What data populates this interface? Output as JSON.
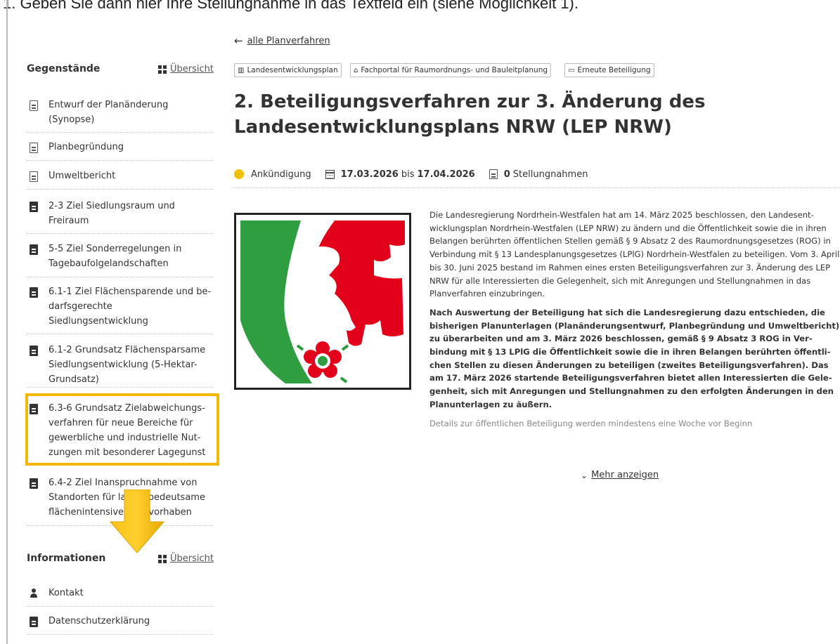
{
  "caption": "1.  Geben Sie dann hier Ihre Stellungnahme in das Textfeld ein (siehe Möglichkeit 1).",
  "sidebar": {
    "gegenstaende": {
      "title": "Gegenstände",
      "overview": "Übersicht",
      "items": [
        {
          "label": "Entwurf der Planänderung (Synopse)",
          "icon": "document-outline-icon"
        },
        {
          "label": "Planbegründung",
          "icon": "document-outline-icon"
        },
        {
          "label": "Umweltbericht",
          "icon": "document-outline-icon"
        },
        {
          "label": "2-3 Ziel Siedlungsraum und Freiraum",
          "icon": "document-filled-icon"
        },
        {
          "label": "5-5 Ziel Sonderregelungen in Tagebaufolgelandschaften",
          "icon": "document-filled-icon"
        },
        {
          "label": "6.1-1 Ziel Flächensparende und be­darfsgerechte Siedlungsentwicklung",
          "icon": "document-filled-icon"
        },
        {
          "label": "6.1-2 Grundsatz Flächensparsame Siedlungsentwicklung (5-Hektar-Grundsatz)",
          "icon": "document-filled-icon"
        },
        {
          "label": "6.3-6 Grundsatz Zielabweichungs­verfahren für neue Bereiche für gewerbliche und industrielle Nut­zungen mit besonderer Lagegunst",
          "icon": "document-filled-icon"
        },
        {
          "label": "6.4-2 Ziel Inanspruchnahme von Standorten für landesbedeutsame flächenintensive Großvorhaben",
          "icon": "document-filled-icon"
        }
      ]
    },
    "informationen": {
      "title": "Informationen",
      "overview": "Übersicht",
      "items": [
        {
          "label": "Kontakt",
          "icon": "user-icon"
        },
        {
          "label": "Datenschutzerklärung",
          "icon": "document-filled-icon"
        }
      ]
    }
  },
  "main": {
    "back_link": "alle Planverfahren",
    "tags": [
      {
        "label": "Landesentwicklungsplan",
        "icon": "map-icon"
      },
      {
        "label": "Fachportal für Raumordnungs- und Bauleitplanung",
        "icon": "institution-icon"
      },
      {
        "label": "Erneute Beteiligung",
        "icon": "comment-icon"
      }
    ],
    "title": "2. Beteiligungsverfahren zur 3. Änderung des Landesentwicklungsplans NRW (LEP NRW)",
    "status": {
      "label": "Ankündigung",
      "color": "#f0c000"
    },
    "date_start": "17.03.2026",
    "date_sep": "bis",
    "date_end": "17.04.2026",
    "statements_count": "0",
    "statements_label": "Stellungnahmen",
    "paragraphs": [
      "Die Landesregierung Nordrhein-Westfalen hat am 14. März 2025 beschlossen, den Landesent­wicklungsplan Nordrhein-Westfalen (LEP NRW) zu ändern und die Öffentlichkeit sowie die in ihren Belangen berührten öffentlichen Stellen gemäß § 9 Absatz 2 des Raumordnungsgesetzes (ROG) in Verbindung mit § 13 Landesplanungsgesetzes (LPlG) Nordrhein-Westfalen zu beteili­gen. Vom 3. April bis 30. Juni 2025 bestand im Rahmen eines ersten Beteiligungsverfahren zur 3. Änderung des LEP NRW für alle Interessierten die Gelegenheit, sich mit Anregungen und Stellungnahmen in das Planverfahren einzubringen.",
      "Nach Auswertung der Beteiligung hat sich die Landesregierung dazu entschieden, die bisherigen Planunterlagen (Planänderungsentwurf, Planbegründung und Umweltbe­richt) zu überarbeiten und am 3. März 2026 beschlossen, gemäß § 9 Absatz 3 ROG in Ver­bindung mit § 13 LPlG die Öffentlichkeit sowie die in ihren Belangen berührten öffentli­chen Stellen zu diesen Änderungen zu beteiligen (zweites Beteiligungsverfahren). Das am 17. März 2026 startende Beteiligungsverfahren bietet allen Interessierten die Gele­genheit, sich mit Anregungen und Stellungnahmen zu den erfolgten Änderungen in den Planunterlagen zu äußern.",
      "Details zur öffentlichen Beteiligung werden mindestens eine Woche vor Beginn"
    ],
    "more_link": "Mehr anzeigen"
  },
  "colors": {
    "highlight": "#f5b800",
    "arrow": "#f5b800",
    "nrw_green": "#2e9e41",
    "nrw_red": "#e3001b"
  }
}
